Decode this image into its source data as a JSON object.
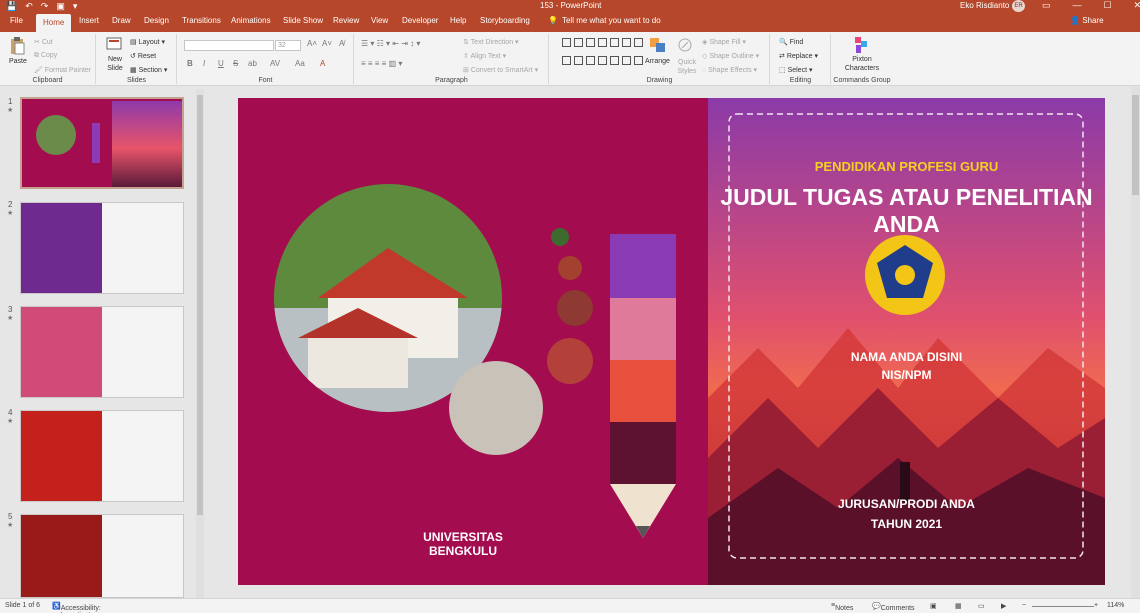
{
  "titlebar": {
    "doc_title": "153  -  PowerPoint",
    "user": "Eko Risdianto",
    "avatar_initials": "ER",
    "qat": [
      "💾",
      "↶",
      "↷",
      "▣",
      "▾"
    ],
    "win_buttons": [
      "▭",
      "—",
      "☐",
      "✕"
    ]
  },
  "tabs": [
    {
      "label": "File"
    },
    {
      "label": "Home"
    },
    {
      "label": "Insert"
    },
    {
      "label": "Draw"
    },
    {
      "label": "Design"
    },
    {
      "label": "Transitions"
    },
    {
      "label": "Animations"
    },
    {
      "label": "Slide Show"
    },
    {
      "label": "Review"
    },
    {
      "label": "View"
    },
    {
      "label": "Developer"
    },
    {
      "label": "Help"
    },
    {
      "label": "Storyboarding"
    }
  ],
  "tellme": "Tell me what you want to do",
  "share": "Share",
  "ribbon": {
    "clipboard": {
      "label": "Clipboard",
      "paste": "Paste",
      "cut": "Cut",
      "copy": "Copy",
      "format_painter": "Format Painter"
    },
    "slides": {
      "label": "Slides",
      "new_slide": "New Slide",
      "layout": "Layout",
      "reset": "Reset",
      "section": "Section"
    },
    "font": {
      "label": "Font",
      "size": "32",
      "bold": "B",
      "italic": "I",
      "underline": "U",
      "strike": "S",
      "shadow": "ab",
      "spacing": "AV",
      "case": "Aa",
      "clear": "A"
    },
    "paragraph": {
      "label": "Paragraph",
      "text_direction": "Text Direction",
      "align_text": "Align Text",
      "smartart": "Convert to SmartArt"
    },
    "drawing": {
      "label": "Drawing",
      "arrange": "Arrange",
      "quick_styles": "Quick Styles",
      "shape_fill": "Shape Fill",
      "shape_outline": "Shape Outline",
      "shape_effects": "Shape Effects"
    },
    "editing": {
      "label": "Editing",
      "find": "Find",
      "replace": "Replace",
      "select": "Select"
    },
    "commands": {
      "label": "Commands Group",
      "pixton": "Pixton Characters"
    }
  },
  "thumbnails": [
    {
      "num": "1",
      "star": "★"
    },
    {
      "num": "2",
      "star": "★"
    },
    {
      "num": "3",
      "star": "★"
    },
    {
      "num": "4",
      "star": "★"
    },
    {
      "num": "5",
      "star": "★"
    }
  ],
  "slide": {
    "subtitle": "PENDIDIKAN PROFESI GURU",
    "title": "JUDUL TUGAS ATAU PENELITIAN ANDA",
    "name": "NAMA ANDA DISINI",
    "nis": "NIS/NPM",
    "prodi": "JURUSAN/PRODI ANDA",
    "year": "TAHUN 2021",
    "university": "UNIVERSITAS BENGKULU"
  },
  "colors": {
    "accent": "#b7472a",
    "slide_bg": "#a30c4e"
  },
  "status": {
    "slide_of": "Slide 1 of 6",
    "accessibility": "Accessibility: Investigate",
    "notes": "Notes",
    "comments": "Comments",
    "zoom": "114%"
  }
}
